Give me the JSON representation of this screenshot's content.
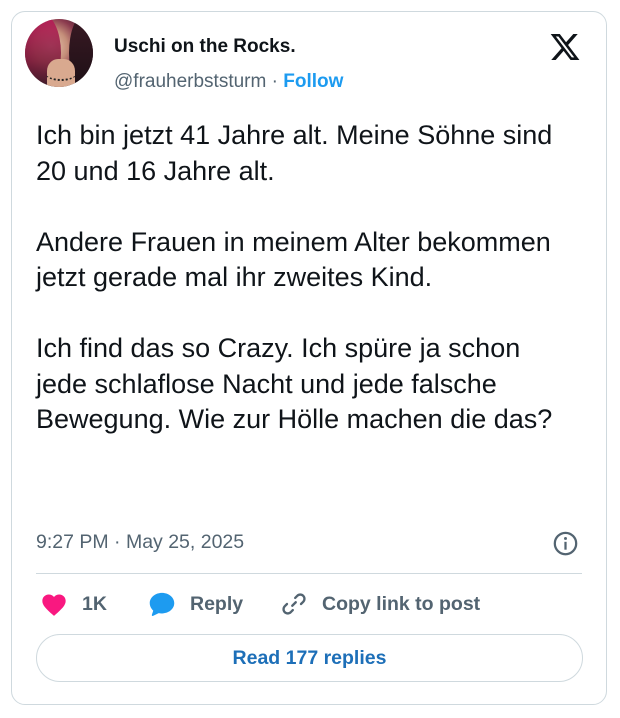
{
  "author": {
    "display_name": "Uschi on the Rocks.",
    "handle": "@frauherbststurm",
    "separator": "·",
    "follow_label": "Follow"
  },
  "tweet": {
    "paragraphs": [
      "Ich bin jetzt 41 Jahre alt. Meine Söhne sind 20 und 16 Jahre alt.",
      "Andere Frauen in meinem Alter bekommen jetzt gerade mal ihr zweites Kind.",
      "Ich find das so Crazy. Ich spüre ja schon jede schlaflose Nacht und jede falsche Bewegung. Wie zur Hölle machen die das?"
    ],
    "timestamp": "9:27 PM · May 25, 2025"
  },
  "actions": {
    "like_count": "1K",
    "reply_label": "Reply",
    "copy_link_label": "Copy link to post"
  },
  "read_replies_label": "Read 177 replies",
  "icons": {
    "platform": "x-logo-icon",
    "info": "info-icon",
    "like": "heart-icon",
    "reply": "speech-bubble-icon",
    "copy": "link-icon"
  },
  "colors": {
    "accent": "#1d9bf0",
    "like": "#f91880",
    "reply_icon": "#1d9bf0",
    "muted_text": "#536471",
    "border": "#cfd9de"
  }
}
